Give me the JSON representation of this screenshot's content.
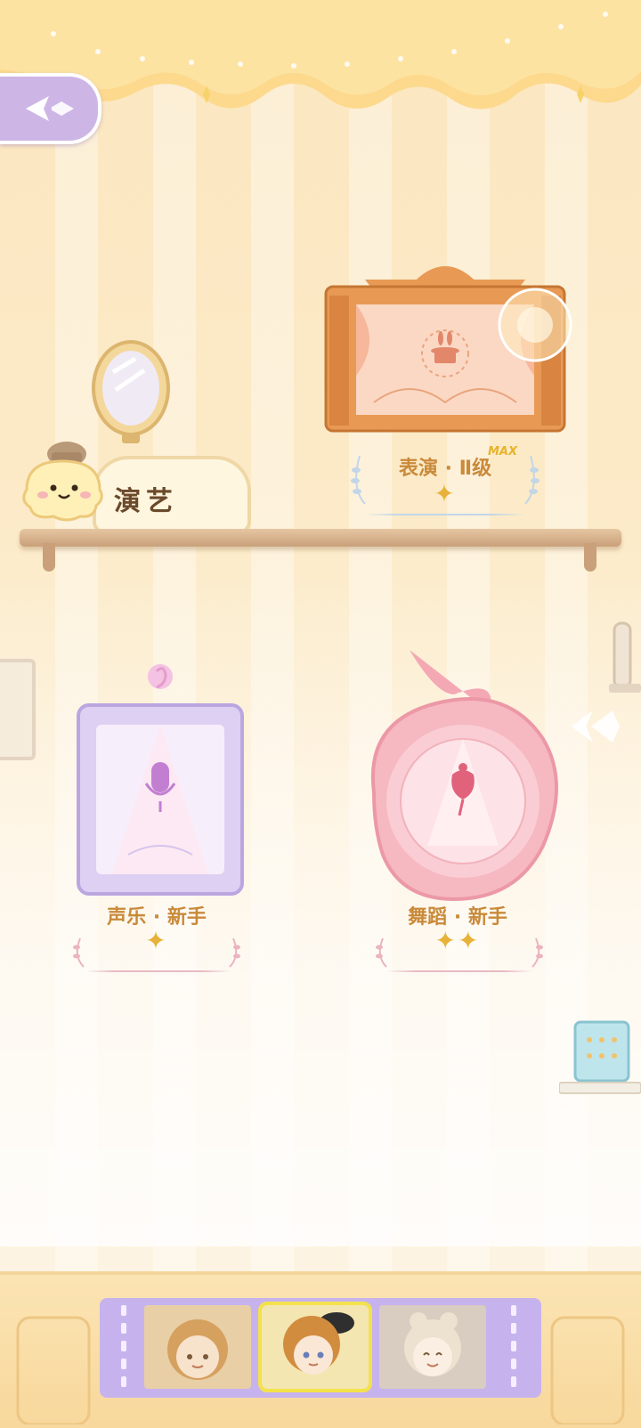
{
  "category_sign": {
    "label": "演艺"
  },
  "skills": [
    {
      "name": "表演 · Ⅱ级",
      "badge": "MAX",
      "stars": "✦"
    },
    {
      "name": "声乐 · 新手",
      "stars": "✦"
    },
    {
      "name": "舞蹈 · 新手",
      "stars": "✦✦"
    }
  ],
  "colors": {
    "accent_gold": "#c98a3a",
    "star": "#e8b23a",
    "lavender": "#c6b3ee",
    "pink": "#f4a8b4",
    "orange_frame": "#e89a55"
  },
  "bottom_strip": {
    "characters": [
      {
        "name": "character-1",
        "selected": false
      },
      {
        "name": "character-2",
        "selected": true
      },
      {
        "name": "character-3",
        "selected": false
      }
    ]
  }
}
